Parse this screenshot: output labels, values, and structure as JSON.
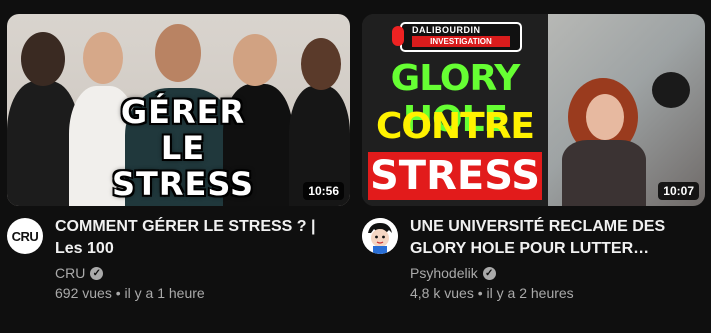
{
  "videos": [
    {
      "thumbnail_title": "GÉRER\nLE STRESS",
      "duration": "10:56",
      "channel_avatar_text": "CRU",
      "title": "COMMENT GÉRER LE STRESS ? | Les 100",
      "channel": "CRU",
      "views": "692 vues",
      "age": "il y a 1 heure"
    },
    {
      "thumbnail_logo_top": "DALIBOURDIN",
      "thumbnail_logo_bottom": "INVESTIGATION",
      "thumbnail_line1": "GLORY HOLE",
      "thumbnail_line2": "CONTRE LE",
      "thumbnail_line3": "STRESS",
      "duration": "10:07",
      "title": "UNE UNIVERSITÉ RECLAME DES GLORY HOLE POUR LUTTER CONTR…",
      "channel": "Psyhodelik",
      "views": "4,8 k vues",
      "age": "il y a 2 heures"
    }
  ],
  "separator": "•",
  "colors": {
    "background": "#0f0f0f",
    "title_text": "#f1f1f1",
    "secondary_text": "#aaaaaa",
    "glory_green": "#66ff33",
    "glory_yellow": "#fff200",
    "stress_red": "#e21b1b"
  },
  "icons": {
    "verified": "check-circle-icon"
  }
}
